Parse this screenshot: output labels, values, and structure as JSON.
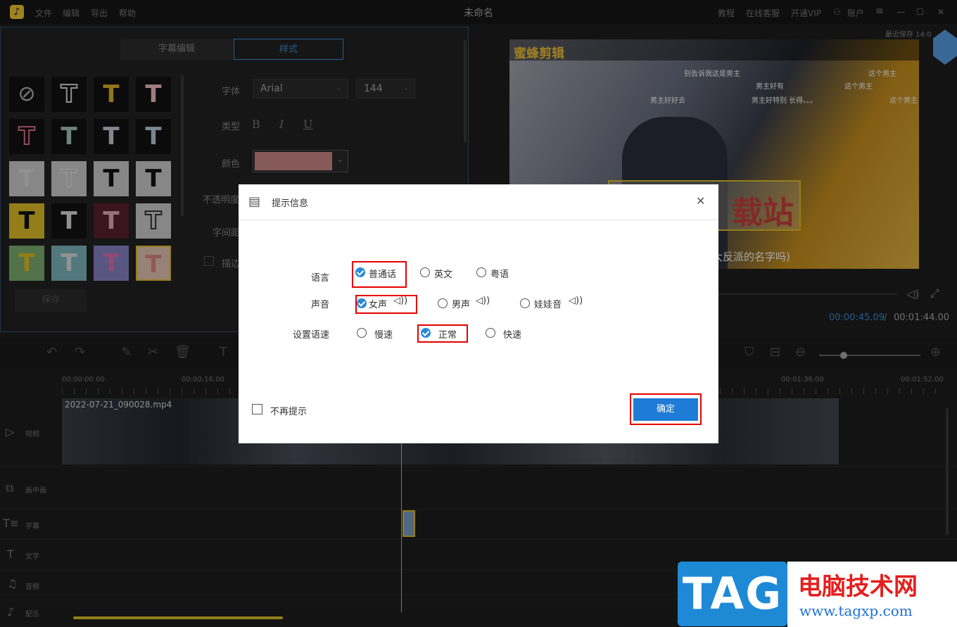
{
  "app": {
    "title": "未命名",
    "menu": [
      "文件",
      "编辑",
      "导出",
      "帮助"
    ],
    "right_menu": [
      "教程",
      "在线客服",
      "开通VIP",
      "账户"
    ],
    "last_saved": "最近保存 14:0"
  },
  "subtitle_panel": {
    "tabs": [
      "字幕编辑",
      "样式"
    ],
    "font_label": "字体",
    "font_value": "Arial",
    "size_value": "144",
    "type_label": "类型",
    "type_buttons": [
      "B",
      "I",
      "U"
    ],
    "color_label": "颜色",
    "color_value": "#d08a8a",
    "opacity_label": "不透明度",
    "spacing_label": "字间距",
    "stroke_label": "描边",
    "save_label": "保存",
    "tile_glyph": "T",
    "no_style_glyph": "⊘"
  },
  "preview": {
    "brand": "蜜蜂剪辑",
    "overlay_text": "载站",
    "caption_text": "大反派的名字吗)",
    "danmu": [
      "别告诉我这是男主",
      "男主好好去",
      "这个男主",
      "男主好有",
      "这个男主",
      "男主好特别 长得。。。",
      "这个男主"
    ],
    "current_time": "00:00:45.09",
    "separator": "/",
    "total_time": "00:01:44.00"
  },
  "dialog": {
    "title": "提示信息",
    "close_glyph": "✕",
    "language_label": "语言",
    "language_options": [
      "普通话",
      "英文",
      "粤语"
    ],
    "language_selected": "普通话",
    "voice_label": "声音",
    "voice_options": [
      "女声",
      "男声",
      "娃娃音"
    ],
    "voice_selected": "女声",
    "speed_label": "设置语速",
    "speed_options": [
      "慢速",
      "正常",
      "快速"
    ],
    "speed_selected": "正常",
    "dont_remind_label": "不再提示",
    "confirm_label": "确定"
  },
  "timeline": {
    "timecodes": [
      "00:00:00.00",
      "00:00:16.00",
      "00:01:36.00",
      "00:01:52.00"
    ],
    "clip_name": "2022-07-21_090028.mp4",
    "tracks": [
      "视频",
      "画中画",
      "字幕",
      "文字",
      "音频",
      "配乐"
    ]
  },
  "watermark": {
    "logo_text": "TAG",
    "site_name": "电脑技术网",
    "url": "www.tagxp.com"
  }
}
